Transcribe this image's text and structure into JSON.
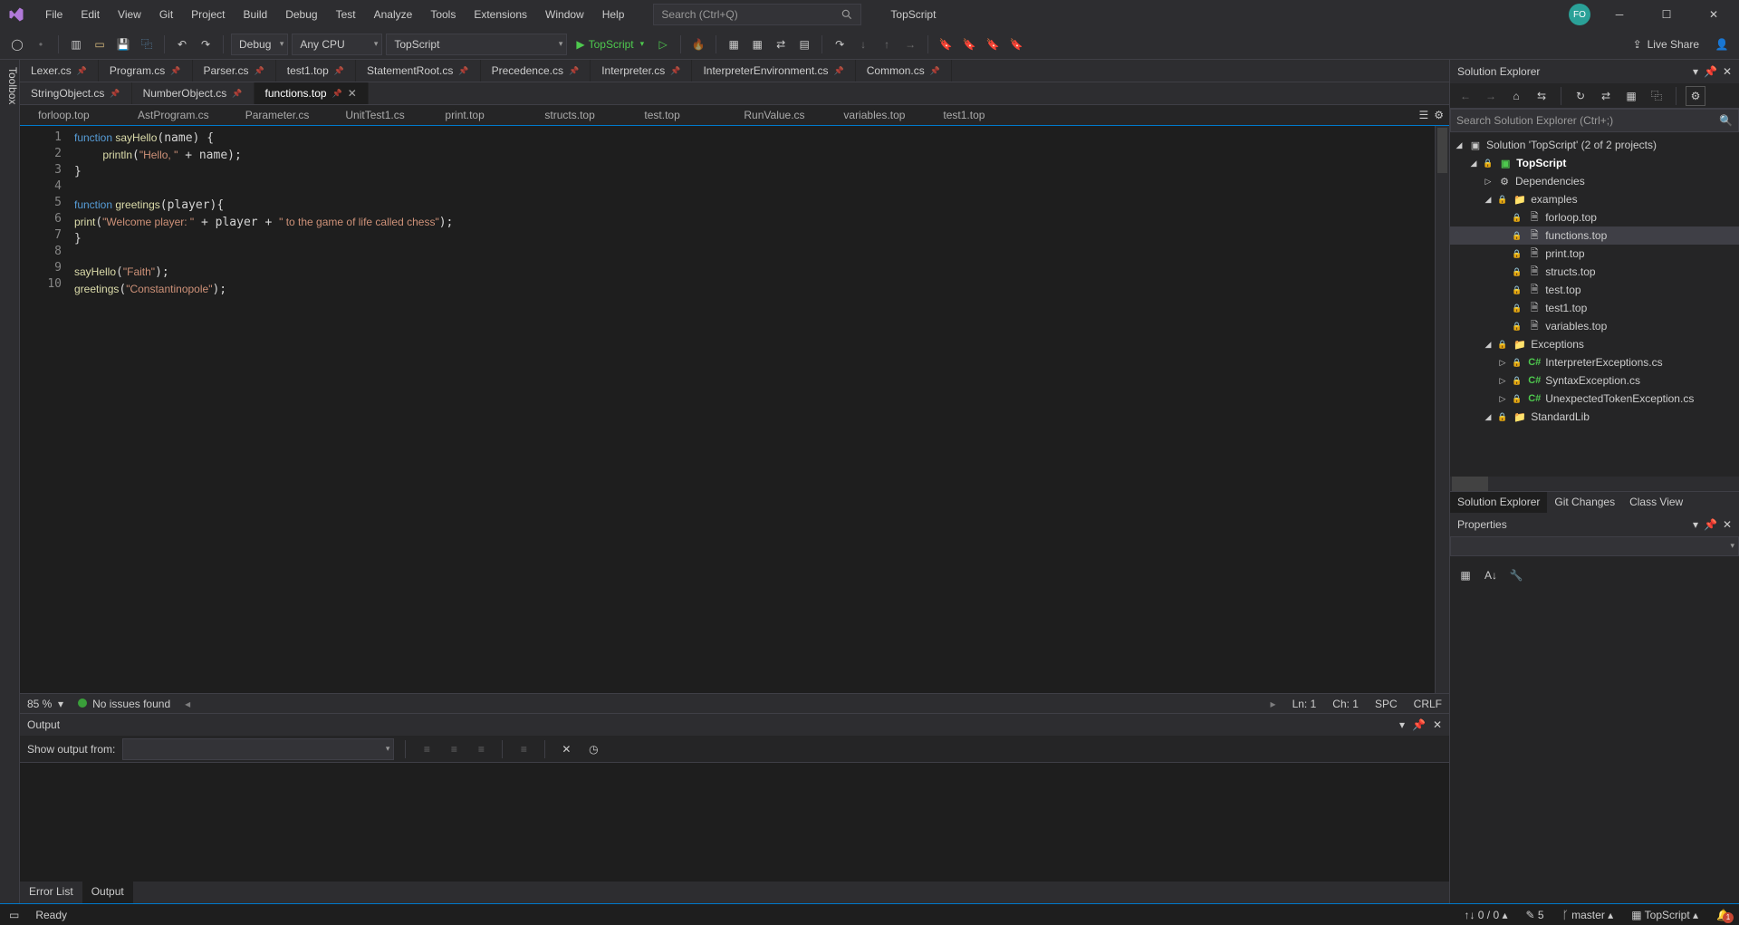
{
  "menu": [
    "File",
    "Edit",
    "View",
    "Git",
    "Project",
    "Build",
    "Debug",
    "Test",
    "Analyze",
    "Tools",
    "Extensions",
    "Window",
    "Help"
  ],
  "search_placeholder": "Search (Ctrl+Q)",
  "app_title": "TopScript",
  "avatar": "FO",
  "toolbar": {
    "config": "Debug",
    "platform": "Any CPU",
    "startup": "TopScript",
    "run_label": "TopScript",
    "live_share": "Live Share"
  },
  "toolbox_label": "Toolbox",
  "doc_tabs_row1": [
    {
      "label": "Lexer.cs",
      "pinned": true
    },
    {
      "label": "Program.cs",
      "pinned": true
    },
    {
      "label": "Parser.cs",
      "pinned": true
    },
    {
      "label": "test1.top",
      "pinned": true
    },
    {
      "label": "StatementRoot.cs",
      "pinned": true
    },
    {
      "label": "Precedence.cs",
      "pinned": true
    },
    {
      "label": "Interpreter.cs",
      "pinned": true
    },
    {
      "label": "InterpreterEnvironment.cs",
      "pinned": true
    },
    {
      "label": "Common.cs",
      "pinned": true
    }
  ],
  "doc_tabs_row2": [
    {
      "label": "StringObject.cs",
      "pinned": true
    },
    {
      "label": "NumberObject.cs",
      "pinned": true
    },
    {
      "label": "functions.top",
      "pinned": true,
      "active": true
    }
  ],
  "sub_tabs": [
    "forloop.top",
    "AstProgram.cs",
    "Parameter.cs",
    "UnitTest1.cs",
    "print.top",
    "structs.top",
    "test.top",
    "RunValue.cs",
    "variables.top",
    "test1.top"
  ],
  "code_lines": [
    [
      {
        "t": "function ",
        "c": "kw"
      },
      {
        "t": "sayHello",
        "c": "fn"
      },
      {
        "t": "(name) {",
        "c": ""
      }
    ],
    [
      {
        "t": "    ",
        "c": ""
      },
      {
        "t": "println",
        "c": "fn"
      },
      {
        "t": "(",
        "c": ""
      },
      {
        "t": "\"Hello, \"",
        "c": "str"
      },
      {
        "t": " + name);",
        "c": ""
      }
    ],
    [
      {
        "t": "}",
        "c": ""
      }
    ],
    [
      {
        "t": "",
        "c": ""
      }
    ],
    [
      {
        "t": "function ",
        "c": "kw"
      },
      {
        "t": "greetings",
        "c": "fn"
      },
      {
        "t": "(player){",
        "c": ""
      }
    ],
    [
      {
        "t": "print",
        "c": "fn"
      },
      {
        "t": "(",
        "c": ""
      },
      {
        "t": "\"Welcome player: \"",
        "c": "str"
      },
      {
        "t": " + player + ",
        "c": ""
      },
      {
        "t": "\" to the game of life called chess\"",
        "c": "str"
      },
      {
        "t": ");",
        "c": ""
      }
    ],
    [
      {
        "t": "}",
        "c": ""
      }
    ],
    [
      {
        "t": "",
        "c": ""
      }
    ],
    [
      {
        "t": "sayHello",
        "c": "fn"
      },
      {
        "t": "(",
        "c": ""
      },
      {
        "t": "\"Faith\"",
        "c": "str"
      },
      {
        "t": ");",
        "c": ""
      }
    ],
    [
      {
        "t": "greetings",
        "c": "fn"
      },
      {
        "t": "(",
        "c": ""
      },
      {
        "t": "\"Constantinopole\"",
        "c": "str"
      },
      {
        "t": ");",
        "c": ""
      }
    ]
  ],
  "editor_status": {
    "zoom": "85 %",
    "issues": "No issues found",
    "ln": "Ln: 1",
    "ch": "Ch: 1",
    "spc": "SPC",
    "crlf": "CRLF"
  },
  "output": {
    "title": "Output",
    "show_from": "Show output from:",
    "dropdown": ""
  },
  "bottom_tabs": [
    {
      "label": "Error List"
    },
    {
      "label": "Output",
      "active": true
    }
  ],
  "solution": {
    "title": "Solution Explorer",
    "search_placeholder": "Search Solution Explorer (Ctrl+;)",
    "root": "Solution 'TopScript' (2 of 2 projects)",
    "project": "TopScript",
    "deps": "Dependencies",
    "examples_folder": "examples",
    "examples": [
      "forloop.top",
      "functions.top",
      "print.top",
      "structs.top",
      "test.top",
      "test1.top",
      "variables.top"
    ],
    "exceptions_folder": "Exceptions",
    "exceptions": [
      "InterpreterExceptions.cs",
      "SyntaxException.cs",
      "UnexpectedTokenException.cs"
    ],
    "stdlib": "StandardLib",
    "tabs": [
      "Solution Explorer",
      "Git Changes",
      "Class View"
    ]
  },
  "properties": {
    "title": "Properties"
  },
  "status": {
    "ready": "Ready",
    "changes": "0 / 0",
    "stash": "5",
    "branch": "master",
    "repo": "TopScript",
    "noti": "1"
  }
}
